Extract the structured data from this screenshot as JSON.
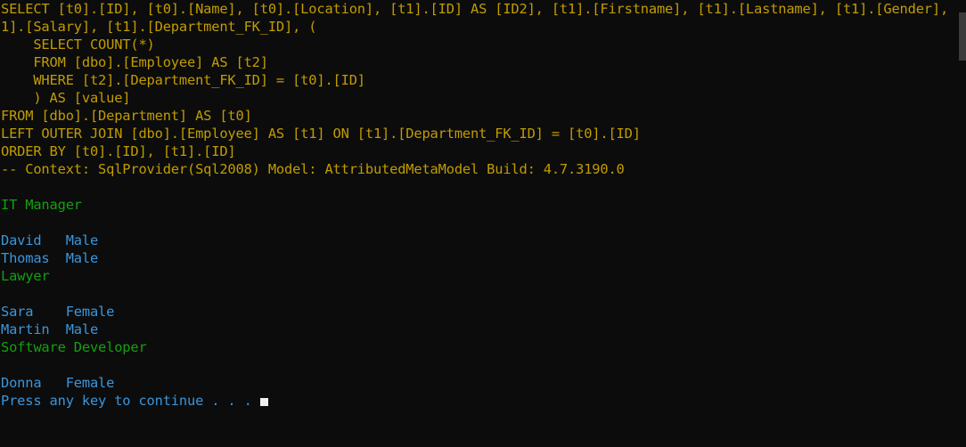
{
  "window": {
    "title": "Console Output",
    "background_color": "#0c0c0c",
    "colors": {
      "yellow": "#c19c00",
      "green": "#13a10e",
      "cyan": "#3a96dd",
      "cursor": "#f0f0f0",
      "scrollbar_thumb": "#3b3b3b"
    }
  },
  "console": {
    "lines": [
      {
        "id": "sql-line-01",
        "color": "yellow",
        "text": "SELECT [t0].[ID], [t0].[Name], [t0].[Location], [t1].[ID] AS [ID2], [t1].[Firstname], [t1].[Lastname], [t1].[Gender], [t"
      },
      {
        "id": "sql-line-02",
        "color": "yellow",
        "text": "1].[Salary], [t1].[Department_FK_ID], ("
      },
      {
        "id": "sql-line-03",
        "color": "yellow",
        "text": "    SELECT COUNT(*)"
      },
      {
        "id": "sql-line-04",
        "color": "yellow",
        "text": "    FROM [dbo].[Employee] AS [t2]"
      },
      {
        "id": "sql-line-05",
        "color": "yellow",
        "text": "    WHERE [t2].[Department_FK_ID] = [t0].[ID]"
      },
      {
        "id": "sql-line-06",
        "color": "yellow",
        "text": "    ) AS [value]"
      },
      {
        "id": "sql-line-07",
        "color": "yellow",
        "text": "FROM [dbo].[Department] AS [t0]"
      },
      {
        "id": "sql-line-08",
        "color": "yellow",
        "text": "LEFT OUTER JOIN [dbo].[Employee] AS [t1] ON [t1].[Department_FK_ID] = [t0].[ID]"
      },
      {
        "id": "sql-line-09",
        "color": "yellow",
        "text": "ORDER BY [t0].[ID], [t1].[ID]"
      },
      {
        "id": "sql-line-10",
        "color": "yellow",
        "text": "-- Context: SqlProvider(Sql2008) Model: AttributedMetaModel Build: 4.7.3190.0"
      },
      {
        "id": "blank-line-01",
        "color": "white",
        "text": ""
      },
      {
        "id": "department-it-manager",
        "color": "green",
        "text": "IT Manager"
      },
      {
        "id": "blank-line-02",
        "color": "white",
        "text": ""
      },
      {
        "id": "employee-david",
        "color": "cyan",
        "text": "David   Male"
      },
      {
        "id": "employee-thomas",
        "color": "cyan",
        "text": "Thomas  Male"
      },
      {
        "id": "department-lawyer",
        "color": "green",
        "text": "Lawyer"
      },
      {
        "id": "blank-line-03",
        "color": "white",
        "text": ""
      },
      {
        "id": "employee-sara",
        "color": "cyan",
        "text": "Sara    Female"
      },
      {
        "id": "employee-martin",
        "color": "cyan",
        "text": "Martin  Male"
      },
      {
        "id": "department-software-developer",
        "color": "green",
        "text": "Software Developer"
      },
      {
        "id": "blank-line-04",
        "color": "white",
        "text": ""
      },
      {
        "id": "employee-donna",
        "color": "cyan",
        "text": "Donna   Female"
      },
      {
        "id": "prompt-press-any-key",
        "color": "cyan",
        "text": "Press any key to continue . . . ",
        "has_cursor": true
      }
    ]
  }
}
